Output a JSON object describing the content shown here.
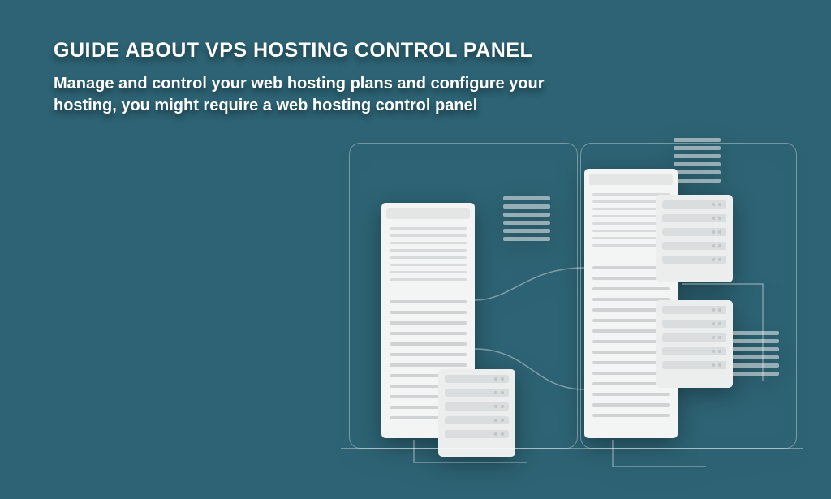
{
  "header": {
    "title": "GUIDE ABOUT VPS HOSTING CONTROL PANEL",
    "subtitle": "Manage and control your web hosting plans and configure your hosting, you might require a web hosting control panel"
  }
}
